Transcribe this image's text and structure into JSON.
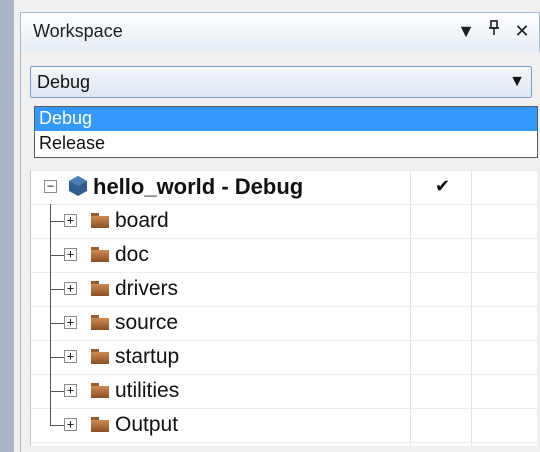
{
  "window": {
    "title": "Workspace"
  },
  "icons": {
    "dropdown": "triangle-down-icon",
    "pin": "pin-icon",
    "close": "close-icon"
  },
  "combo": {
    "value": "Debug"
  },
  "dropdown_options": [
    {
      "label": "Debug",
      "selected": true
    },
    {
      "label": "Release",
      "selected": false
    }
  ],
  "tree": {
    "project": {
      "label": "hello_world - Debug",
      "checked_mark": "✔"
    },
    "folders": [
      {
        "label": "board"
      },
      {
        "label": "doc"
      },
      {
        "label": "drivers"
      },
      {
        "label": "source"
      },
      {
        "label": "startup"
      },
      {
        "label": "utilities"
      },
      {
        "label": "Output"
      }
    ]
  },
  "colors": {
    "selection": "#3399ff",
    "folder": "#b8703a",
    "project_icon": "#2f5f8f"
  }
}
